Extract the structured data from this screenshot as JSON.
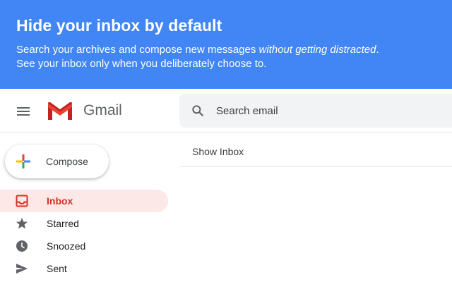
{
  "banner": {
    "title": "Hide your inbox by default",
    "line1_prefix": "Search your archives and compose new messages ",
    "line1_emphasis": "without getting distracted",
    "line1_suffix": ".",
    "line2": "See your inbox only when you deliberately choose to.",
    "color": "#4285f4"
  },
  "header": {
    "menu_icon": "hamburger-menu-icon",
    "logo_icon": "gmail-logo-icon",
    "brand": "Gmail"
  },
  "search": {
    "icon": "search-icon",
    "placeholder": "Search email"
  },
  "compose": {
    "icon": "plus-icon",
    "label": "Compose"
  },
  "nav": {
    "active_color": "#d93025",
    "items": [
      {
        "label": "Inbox",
        "icon": "inbox-icon",
        "active": true
      },
      {
        "label": "Starred",
        "icon": "star-icon",
        "active": false
      },
      {
        "label": "Snoozed",
        "icon": "clock-icon",
        "active": false
      },
      {
        "label": "Sent",
        "icon": "send-icon",
        "active": false
      }
    ]
  },
  "main": {
    "show_inbox_label": "Show Inbox"
  }
}
